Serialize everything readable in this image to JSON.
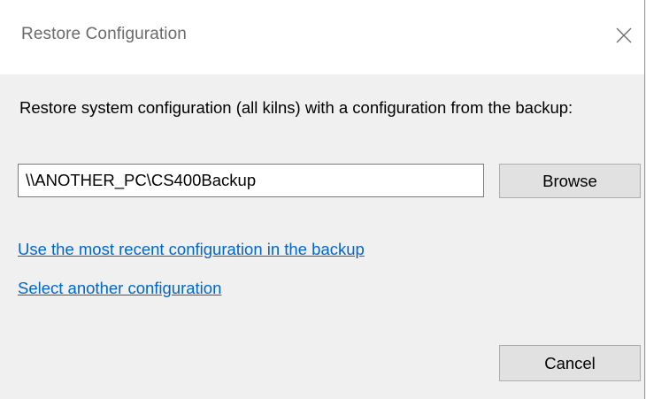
{
  "dialog": {
    "title": "Restore Configuration",
    "close_icon": "close-icon",
    "prompt": "Restore system configuration (all kilns) with a configuration from the backup:",
    "path_value": "\\\\ANOTHER_PC\\CS400Backup",
    "browse_label": "Browse",
    "links": {
      "recent": "Use the most recent configuration in the backup",
      "select_another": "Select another configuration"
    },
    "cancel_label": "Cancel"
  },
  "colors": {
    "link": "#0066cc",
    "button_bg": "#e1e1e1",
    "title_text": "#6b6b6b"
  }
}
